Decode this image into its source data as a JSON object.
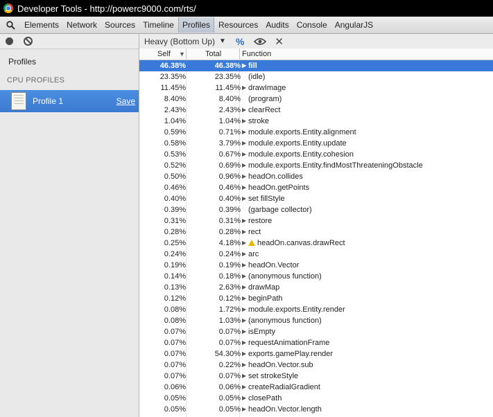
{
  "window": {
    "title": "Developer Tools - http://powerc9000.com/rts/"
  },
  "tabs": [
    {
      "label": "Elements"
    },
    {
      "label": "Network"
    },
    {
      "label": "Sources"
    },
    {
      "label": "Timeline"
    },
    {
      "label": "Profiles"
    },
    {
      "label": "Resources"
    },
    {
      "label": "Audits"
    },
    {
      "label": "Console"
    },
    {
      "label": "AngularJS"
    }
  ],
  "active_tab": "Profiles",
  "sidebar": {
    "title": "Profiles",
    "section": "CPU PROFILES",
    "profile_name": "Profile 1",
    "save_label": "Save"
  },
  "profile_toolbar": {
    "view_mode": "Heavy (Bottom Up)",
    "percent_symbol": "%"
  },
  "columns": {
    "self": "Self",
    "total": "Total",
    "function": "Function"
  },
  "rows": [
    {
      "self": "46.38%",
      "total": "46.38%",
      "func": "fill",
      "expand": true,
      "selected": true
    },
    {
      "self": "23.35%",
      "total": "23.35%",
      "func": "(idle)",
      "expand": false
    },
    {
      "self": "11.45%",
      "total": "11.45%",
      "func": "drawImage",
      "expand": true
    },
    {
      "self": "8.40%",
      "total": "8.40%",
      "func": "(program)",
      "expand": false
    },
    {
      "self": "2.43%",
      "total": "2.43%",
      "func": "clearRect",
      "expand": true
    },
    {
      "self": "1.04%",
      "total": "1.04%",
      "func": "stroke",
      "expand": true
    },
    {
      "self": "0.59%",
      "total": "0.71%",
      "func": "module.exports.Entity.alignment",
      "expand": true
    },
    {
      "self": "0.58%",
      "total": "3.79%",
      "func": "module.exports.Entity.update",
      "expand": true
    },
    {
      "self": "0.53%",
      "total": "0.67%",
      "func": "module.exports.Entity.cohesion",
      "expand": true
    },
    {
      "self": "0.52%",
      "total": "0.69%",
      "func": "module.exports.Entity.findMostThreateningObstacle",
      "expand": true
    },
    {
      "self": "0.50%",
      "total": "0.96%",
      "func": "headOn.collides",
      "expand": true
    },
    {
      "self": "0.46%",
      "total": "0.46%",
      "func": "headOn.getPoints",
      "expand": true
    },
    {
      "self": "0.40%",
      "total": "0.40%",
      "func": "set fillStyle",
      "expand": true
    },
    {
      "self": "0.39%",
      "total": "0.39%",
      "func": "(garbage collector)",
      "expand": false
    },
    {
      "self": "0.31%",
      "total": "0.31%",
      "func": "restore",
      "expand": true
    },
    {
      "self": "0.28%",
      "total": "0.28%",
      "func": "rect",
      "expand": true
    },
    {
      "self": "0.25%",
      "total": "4.18%",
      "func": "headOn.canvas.drawRect",
      "expand": true,
      "warning": true
    },
    {
      "self": "0.24%",
      "total": "0.24%",
      "func": "arc",
      "expand": true
    },
    {
      "self": "0.19%",
      "total": "0.19%",
      "func": "headOn.Vector",
      "expand": true
    },
    {
      "self": "0.14%",
      "total": "0.18%",
      "func": "(anonymous function)",
      "expand": true
    },
    {
      "self": "0.13%",
      "total": "2.63%",
      "func": "drawMap",
      "expand": true
    },
    {
      "self": "0.12%",
      "total": "0.12%",
      "func": "beginPath",
      "expand": true
    },
    {
      "self": "0.08%",
      "total": "1.72%",
      "func": "module.exports.Entity.render",
      "expand": true
    },
    {
      "self": "0.08%",
      "total": "1.03%",
      "func": "(anonymous function)",
      "expand": true
    },
    {
      "self": "0.07%",
      "total": "0.07%",
      "func": "isEmpty",
      "expand": true
    },
    {
      "self": "0.07%",
      "total": "0.07%",
      "func": "requestAnimationFrame",
      "expand": true
    },
    {
      "self": "0.07%",
      "total": "54.30%",
      "func": "exports.gamePlay.render",
      "expand": true
    },
    {
      "self": "0.07%",
      "total": "0.22%",
      "func": "headOn.Vector.sub",
      "expand": true
    },
    {
      "self": "0.07%",
      "total": "0.07%",
      "func": "set strokeStyle",
      "expand": true
    },
    {
      "self": "0.06%",
      "total": "0.06%",
      "func": "createRadialGradient",
      "expand": true
    },
    {
      "self": "0.05%",
      "total": "0.05%",
      "func": "closePath",
      "expand": true
    },
    {
      "self": "0.05%",
      "total": "0.05%",
      "func": "headOn.Vector.length",
      "expand": true
    }
  ],
  "colors": {
    "selection": "#3879d9",
    "sidebar_selection": "#3c7ad3",
    "warning": "#e8b800"
  }
}
